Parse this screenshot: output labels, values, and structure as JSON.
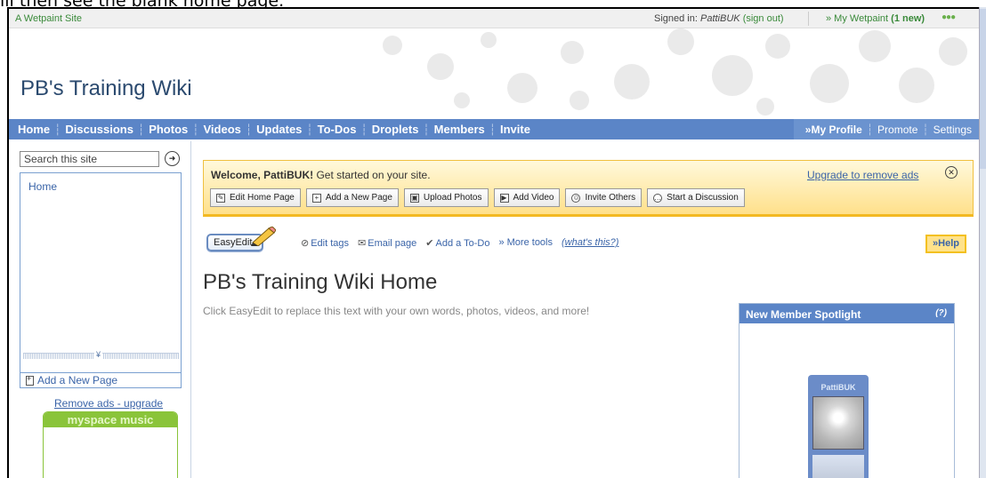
{
  "caption": "ill then see the blank home page.",
  "topbar": {
    "site_link": "A Wetpaint Site",
    "signed_in_prefix": "Signed in: ",
    "username": "PattiBUK",
    "sign_out": "(sign out)",
    "my_wetpaint": "» My Wetpaint",
    "new_count": "(1 new)"
  },
  "header": {
    "site_title": "PB's Training Wiki"
  },
  "nav": {
    "tabs": [
      "Home",
      "Discussions",
      "Photos",
      "Videos",
      "Updates",
      "To-Dos",
      "Droplets",
      "Members",
      "Invite"
    ],
    "right": {
      "my_profile": "»My Profile",
      "promote": "Promote",
      "settings": "Settings"
    }
  },
  "sidebar": {
    "search_placeholder": "Search this site",
    "pages": [
      "Home"
    ],
    "add_page": "Add a New Page",
    "remove_ads": "Remove ads - upgrade",
    "ad_brand_a": "myspace",
    "ad_brand_b": "music"
  },
  "welcome": {
    "greeting": "Welcome, PattiBUK!",
    "text": " Get started on your site.",
    "upgrade": "Upgrade to remove ads",
    "buttons": [
      "Edit Home Page",
      "Add a New Page",
      "Upload Photos",
      "Add Video",
      "Invite Others",
      "Start a Discussion"
    ]
  },
  "toolbar": {
    "easyedit": "EasyEdit",
    "edit_tags": "Edit tags",
    "email_page": "Email page",
    "add_todo": "Add a To-Do",
    "more_tools": "» More tools",
    "whats_this": "(what's this?)",
    "help": "»Help"
  },
  "main": {
    "page_title": "PB's Training Wiki Home",
    "placeholder": "Click EasyEdit to replace this text with your own words, photos, videos, and more!"
  },
  "spotlight": {
    "title": "New Member Spotlight",
    "help": "(?)",
    "member_name": "PattiBUK"
  },
  "colors": {
    "nav": "#5b85c7",
    "brand_green": "#3a8a3a",
    "welcome_bg": "#ffe08a"
  }
}
